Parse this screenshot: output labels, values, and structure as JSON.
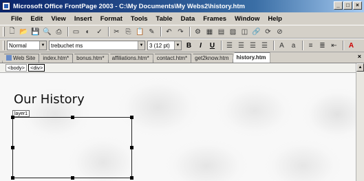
{
  "window": {
    "title": "Microsoft Office FrontPage 2003 - C:\\My Documents\\My Webs2\\history.htm",
    "min_glyph": "_",
    "max_glyph": "□",
    "close_glyph": "×"
  },
  "menu": [
    {
      "label": "File"
    },
    {
      "label": "Edit"
    },
    {
      "label": "View"
    },
    {
      "label": "Insert"
    },
    {
      "label": "Format"
    },
    {
      "label": "Tools"
    },
    {
      "label": "Table"
    },
    {
      "label": "Data"
    },
    {
      "label": "Frames"
    },
    {
      "label": "Window"
    },
    {
      "label": "Help"
    }
  ],
  "formatting": {
    "style": "Normal",
    "font": "trebuchet ms",
    "size": "3 (12 pt)",
    "bold": "B",
    "italic": "I",
    "underline": "U"
  },
  "tabs": [
    {
      "label": "Web Site",
      "active": false
    },
    {
      "label": "index.htm*",
      "active": false
    },
    {
      "label": "bonus.htm*",
      "active": false
    },
    {
      "label": "affiliations.htm*",
      "active": false
    },
    {
      "label": "contact.htm*",
      "active": false
    },
    {
      "label": "get2know.htm",
      "active": false
    },
    {
      "label": "history.htm",
      "active": true
    }
  ],
  "tabs_close": "×",
  "quick_tags": [
    "<body>",
    "<div>"
  ],
  "editor": {
    "heading": "Our History",
    "layer_label": "layer1"
  },
  "colors": {
    "title_start": "#0a246a",
    "title_end": "#a6caf0",
    "chrome": "#d4d0c8"
  }
}
